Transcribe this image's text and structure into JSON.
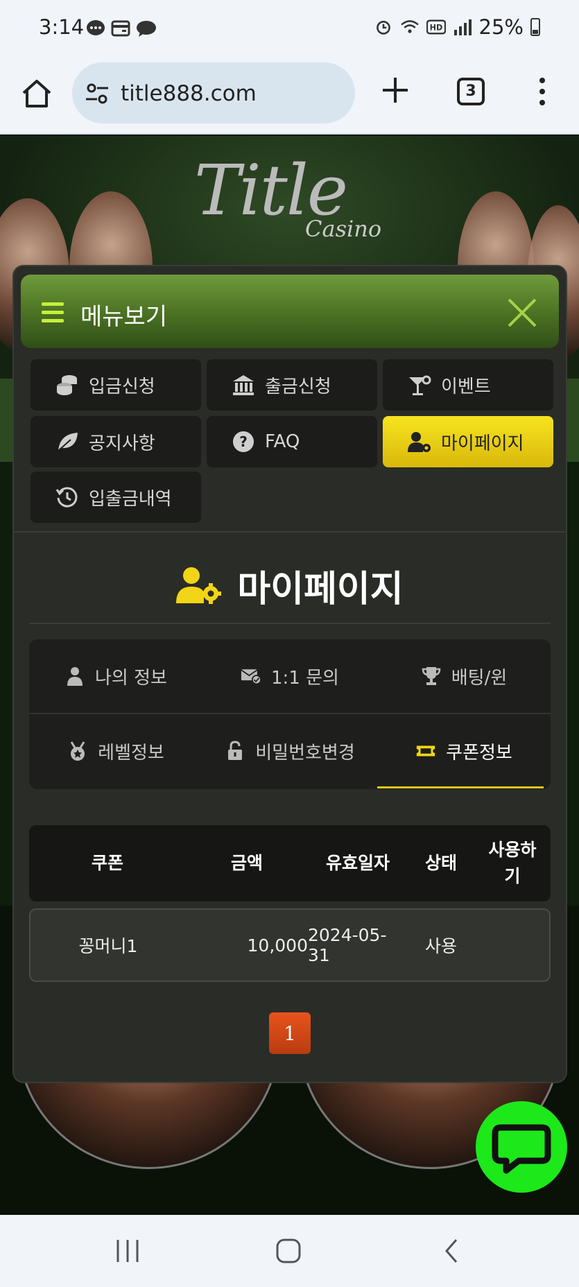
{
  "status_bar": {
    "time": "3:14",
    "battery": "25%"
  },
  "browser": {
    "url": "title888.com",
    "tab_count": "3"
  },
  "background": {
    "logo": "Title",
    "logo_sub": "Casino"
  },
  "menu": {
    "title": "메뉴보기",
    "items": [
      {
        "label": "입금신청",
        "icon": "coins-icon"
      },
      {
        "label": "출금신청",
        "icon": "bank-icon"
      },
      {
        "label": "이벤트",
        "icon": "cocktail-icon"
      },
      {
        "label": "공지사항",
        "icon": "leaf-icon"
      },
      {
        "label": "FAQ",
        "icon": "question-icon"
      },
      {
        "label": "마이페이지",
        "icon": "user-gear-icon",
        "active": true
      },
      {
        "label": "입출금내역",
        "icon": "history-icon"
      }
    ]
  },
  "mypage": {
    "title": "마이페이지",
    "tabs": [
      {
        "label": "나의 정보",
        "icon": "user-icon"
      },
      {
        "label": "1:1 문의",
        "icon": "mail-check-icon"
      },
      {
        "label": "배팅/윈",
        "icon": "trophy-icon"
      },
      {
        "label": "레벨정보",
        "icon": "medal-icon"
      },
      {
        "label": "비밀번호변경",
        "icon": "lock-icon"
      },
      {
        "label": "쿠폰정보",
        "icon": "ticket-icon",
        "active": true
      }
    ]
  },
  "coupon_table": {
    "headers": [
      "쿠폰",
      "금액",
      "유효일자",
      "상태",
      "사용하\n기"
    ],
    "rows": [
      {
        "name": "꽁머니1",
        "amount": "10,000",
        "expiry": "2024-05-31",
        "status": "사용",
        "use": ""
      }
    ]
  },
  "pagination": {
    "current": "1"
  },
  "colors": {
    "accent_yellow": "#f2d516",
    "header_green": "#5a8430",
    "chat_green": "#1de81a",
    "page_orange": "#d9481a"
  }
}
